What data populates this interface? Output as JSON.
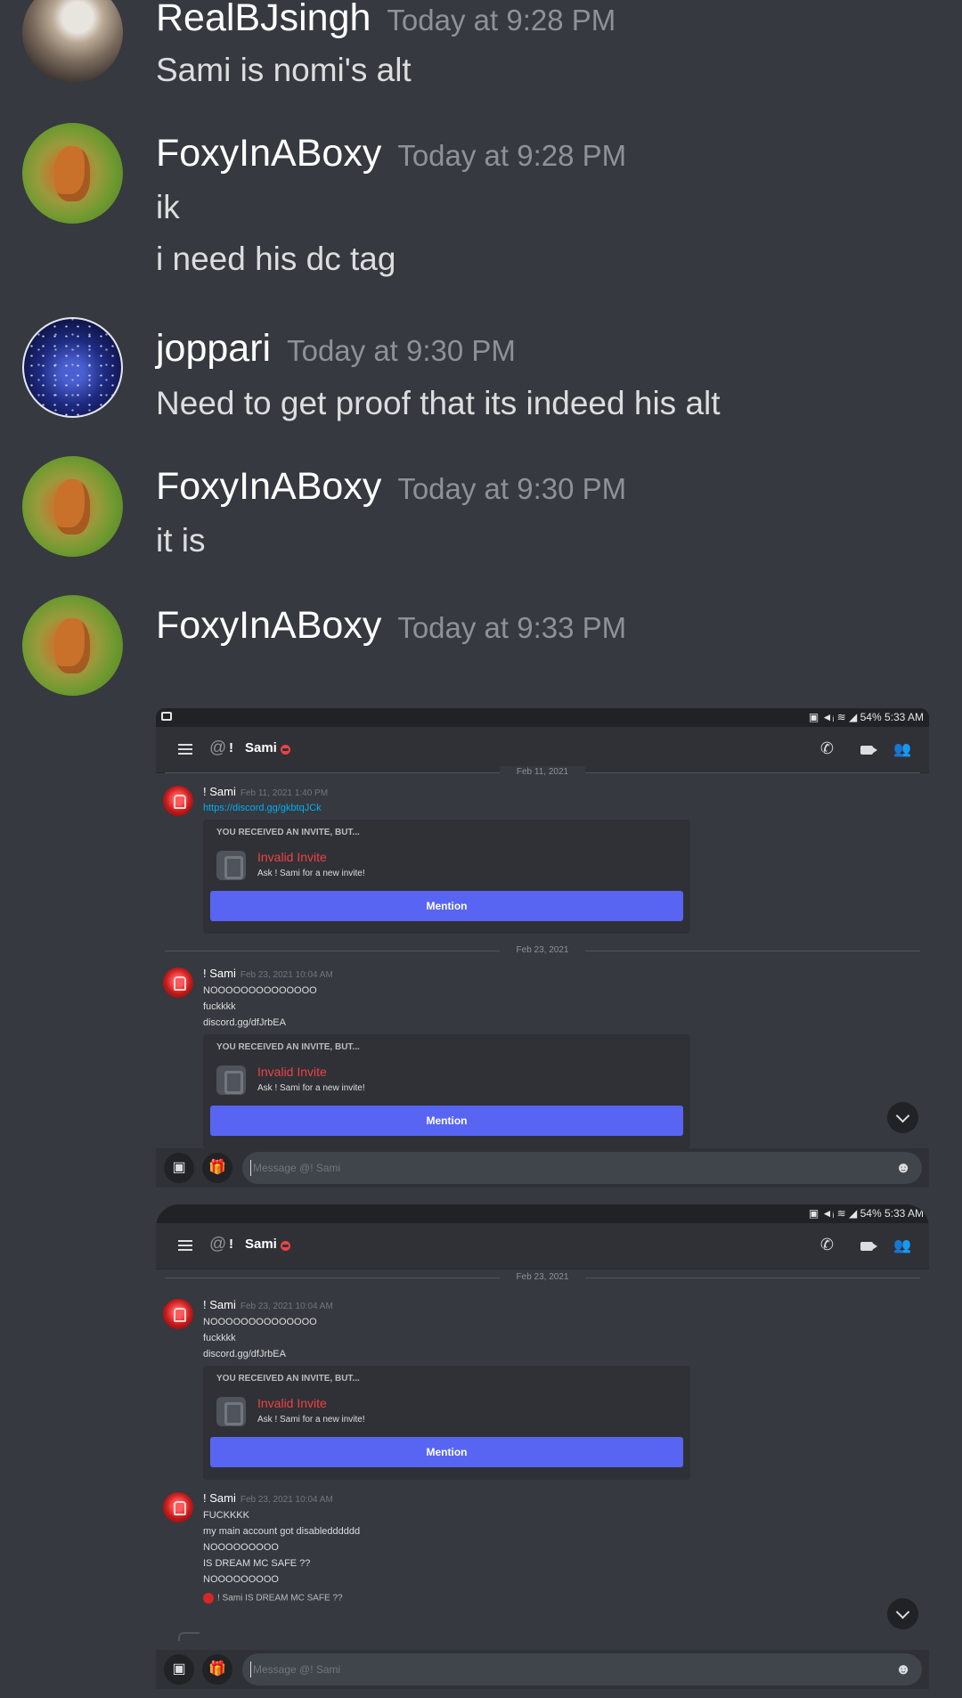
{
  "chat": {
    "messages": [
      {
        "author": "RealBJsingh",
        "timestamp": "Today at 9:28 PM",
        "avatar": "cat-avatar",
        "lines": [
          "Sami is nomi's alt"
        ]
      },
      {
        "author": "FoxyInABoxy",
        "timestamp": "Today at 9:28 PM",
        "avatar": "fox-avatar",
        "lines": [
          "ik",
          "i need his dc tag"
        ]
      },
      {
        "author": "joppari",
        "timestamp": "Today at 9:30 PM",
        "avatar": "space-avatar",
        "lines": [
          "Need to get proof that its indeed his alt"
        ]
      },
      {
        "author": "FoxyInABoxy",
        "timestamp": "Today at 9:30 PM",
        "avatar": "fox-avatar",
        "lines": [
          "it is"
        ]
      },
      {
        "author": "FoxyInABoxy",
        "timestamp": "Today at 9:33 PM",
        "avatar": "fox-avatar",
        "lines": []
      }
    ]
  },
  "screenshots": [
    {
      "status_bar": "54% 5:33 AM",
      "channel": {
        "prefix": "!",
        "name": "Sami"
      },
      "dividers": [
        "Feb 11, 2021",
        "Feb 23, 2021"
      ],
      "messages": [
        {
          "author": "!  Sami",
          "timestamp": "Feb 11, 2021 1:40 PM",
          "link": "https://discord.gg/gkbtqJCk",
          "invite": {
            "header": "YOU RECEIVED AN INVITE, BUT...",
            "title": "Invalid Invite",
            "subtitle": "Ask !  Sami for a new invite!",
            "button": "Mention"
          }
        },
        {
          "author": "!  Sami",
          "timestamp": "Feb 23, 2021 10:04 AM",
          "lines": [
            "NOOOOOOOOOOOOOO",
            "fuckkkk",
            "discord.gg/dfJrbEA"
          ],
          "invite": {
            "header": "YOU RECEIVED AN INVITE, BUT...",
            "title": "Invalid Invite",
            "subtitle": "Ask !  Sami for a new invite!",
            "button": "Mention"
          }
        }
      ],
      "input_placeholder": "Message @!  Sami"
    },
    {
      "status_bar": "54% 5:33 AM",
      "channel": {
        "prefix": "!",
        "name": "Sami"
      },
      "dividers": [
        "Feb 23, 2021"
      ],
      "messages": [
        {
          "author": "!  Sami",
          "timestamp": "Feb 23, 2021 10:04 AM",
          "lines": [
            "NOOOOOOOOOOOOOO",
            "fuckkkk",
            "discord.gg/dfJrbEA"
          ],
          "invite": {
            "header": "YOU RECEIVED AN INVITE, BUT...",
            "title": "Invalid Invite",
            "subtitle": "Ask !  Sami for a new invite!",
            "button": "Mention"
          }
        },
        {
          "author": "!  Sami",
          "timestamp": "Feb 23, 2021 10:04 AM",
          "lines": [
            "FUCKKKK",
            "my main account got disabledddddd",
            "NOOOOOOOOO",
            "IS DREAM MC SAFE ??",
            "NOOOOOOOOO"
          ]
        }
      ],
      "reply_preview": "!  Sami  IS DREAM MC SAFE ??",
      "input_placeholder": "Message @!  Sami"
    }
  ],
  "colors": {
    "background": "#36393f",
    "blurple": "#5865f2",
    "invalid": "#ed4245",
    "link": "#00aff4"
  }
}
